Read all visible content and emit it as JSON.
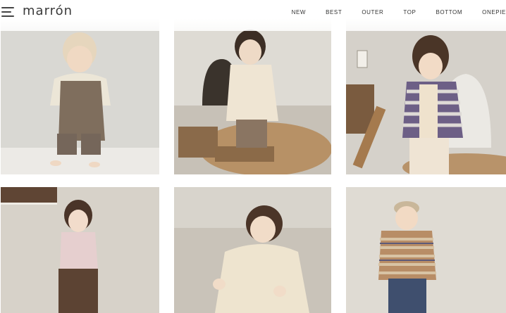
{
  "brand": {
    "logo_text": "marrón"
  },
  "header": {
    "menu_icon": "hamburger-menu-icon"
  },
  "nav": {
    "items": [
      {
        "label": "NEW"
      },
      {
        "label": "BEST"
      },
      {
        "label": "OUTER"
      },
      {
        "label": "TOP"
      },
      {
        "label": "BOTTOM"
      },
      {
        "label": "ONEPIE"
      }
    ]
  },
  "products": [
    {
      "kind": "photo"
    },
    {
      "kind": "photo"
    },
    {
      "kind": "photo"
    },
    {
      "kind": "photo"
    },
    {
      "kind": "photo"
    },
    {
      "kind": "photo"
    }
  ]
}
